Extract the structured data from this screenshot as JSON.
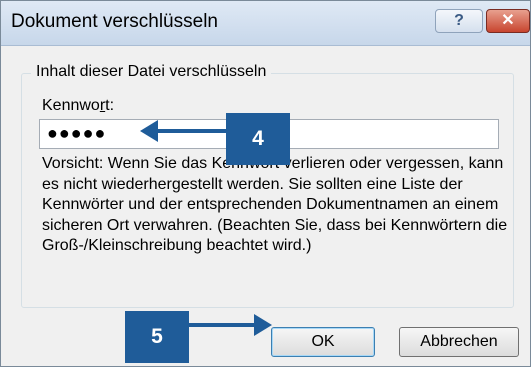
{
  "window": {
    "title": "Dokument verschlüsseln",
    "help_glyph": "?",
    "close_glyph": "✕"
  },
  "group": {
    "legend": "Inhalt dieser Datei verschlüsseln",
    "password_label_before": "Kennwo",
    "password_label_accel": "r",
    "password_label_after": "t:",
    "password_value": "●●●●●",
    "warning_text": "Vorsicht: Wenn Sie das Kennwort verlieren oder vergessen, kann es nicht wiederhergestellt werden. Sie sollten eine Liste der Kennwörter und der entsprechenden Dokumentnamen an einem sicheren Ort verwahren. (Beachten Sie, dass bei Kennwörtern die Groß-/Kleinschreibung beachtet wird.)"
  },
  "buttons": {
    "ok": "OK",
    "cancel": "Abbrechen"
  },
  "callouts": {
    "step_4": "4",
    "step_5": "5"
  },
  "colors": {
    "callout_blue": "#1f5c99",
    "close_red": "#c8452f"
  }
}
